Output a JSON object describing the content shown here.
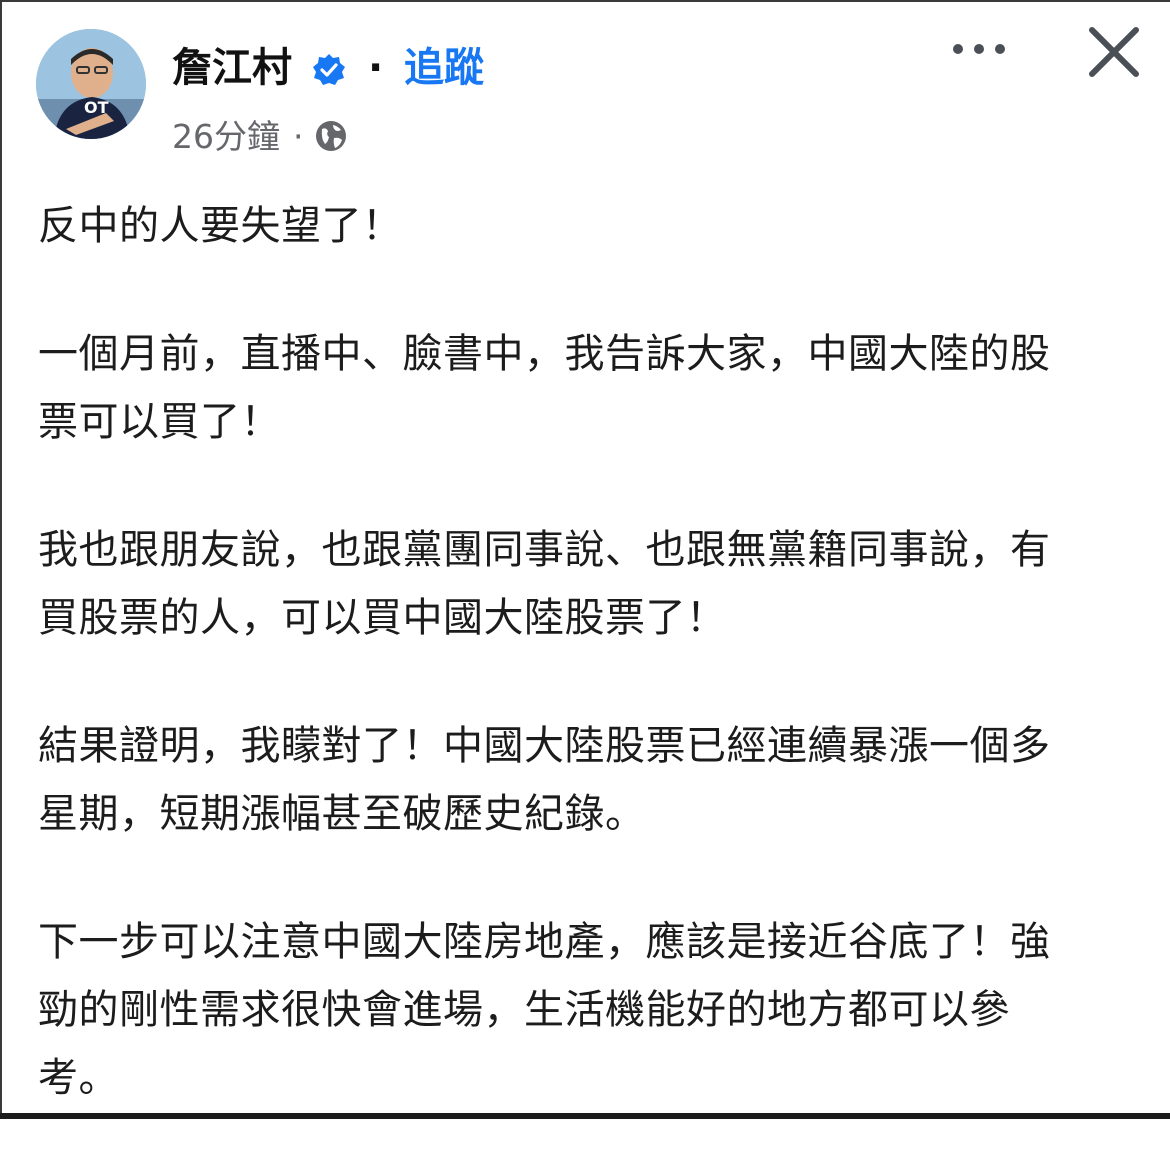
{
  "post": {
    "author": {
      "name": "詹江村",
      "avatar_shirt_text": "OT"
    },
    "separator": "·",
    "follow_label": "追蹤",
    "timestamp": "26分鐘",
    "meta_separator": "·",
    "icons": {
      "verified": "verified-badge-icon",
      "privacy": "globe-icon",
      "more": "more-options-icon",
      "close": "close-icon"
    },
    "colors": {
      "accent": "#1877f2",
      "meta": "#65676b",
      "text": "#1c1c1c"
    },
    "paragraphs": [
      "反中的人要失望了！",
      "一個月前，直播中、臉書中，我告訴大家，中國大陸的股\n票可以買了！",
      "我也跟朋友說，也跟黨團同事說、也跟無黨籍同事說，有\n買股票的人，可以買中國大陸股票了！",
      "結果證明，我矇對了！中國大陸股票已經連續暴漲一個多\n星期，短期漲幅甚至破歷史紀錄。",
      "下一步可以注意中國大陸房地產，應該是接近谷底了！強\n勁的剛性需求很快會進場，生活機能好的地方都可以參\n考。"
    ]
  }
}
